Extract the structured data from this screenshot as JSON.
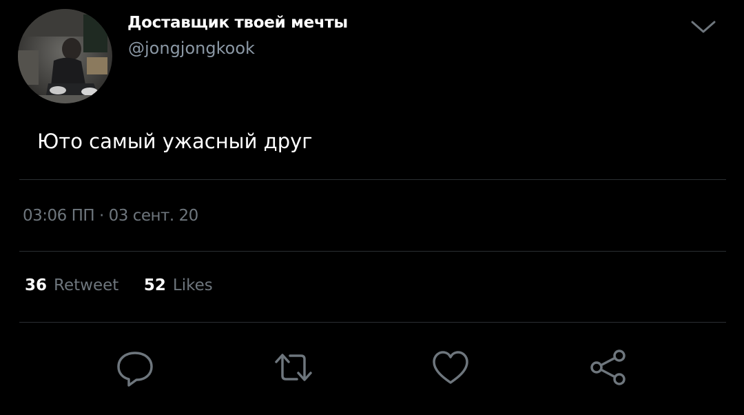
{
  "tweet": {
    "display_name": "Доставщик твоей мечты",
    "handle": "@jongjongkook",
    "text": "Юто самый ужасный друг",
    "timestamp": "03:06 ПП · 03 сент. 20",
    "stats": {
      "retweet_count": "36",
      "retweet_label": "Retweet",
      "likes_count": "52",
      "likes_label": "Likes"
    }
  },
  "icons": {
    "menu": "chevron-down-icon",
    "reply": "reply-icon",
    "retweet": "retweet-icon",
    "like": "heart-icon",
    "share": "share-icon"
  },
  "colors": {
    "background": "#000000",
    "text": "#ffffff",
    "muted": "#8b98a5",
    "icon": "#6e767d",
    "divider": "#2b2f33"
  }
}
